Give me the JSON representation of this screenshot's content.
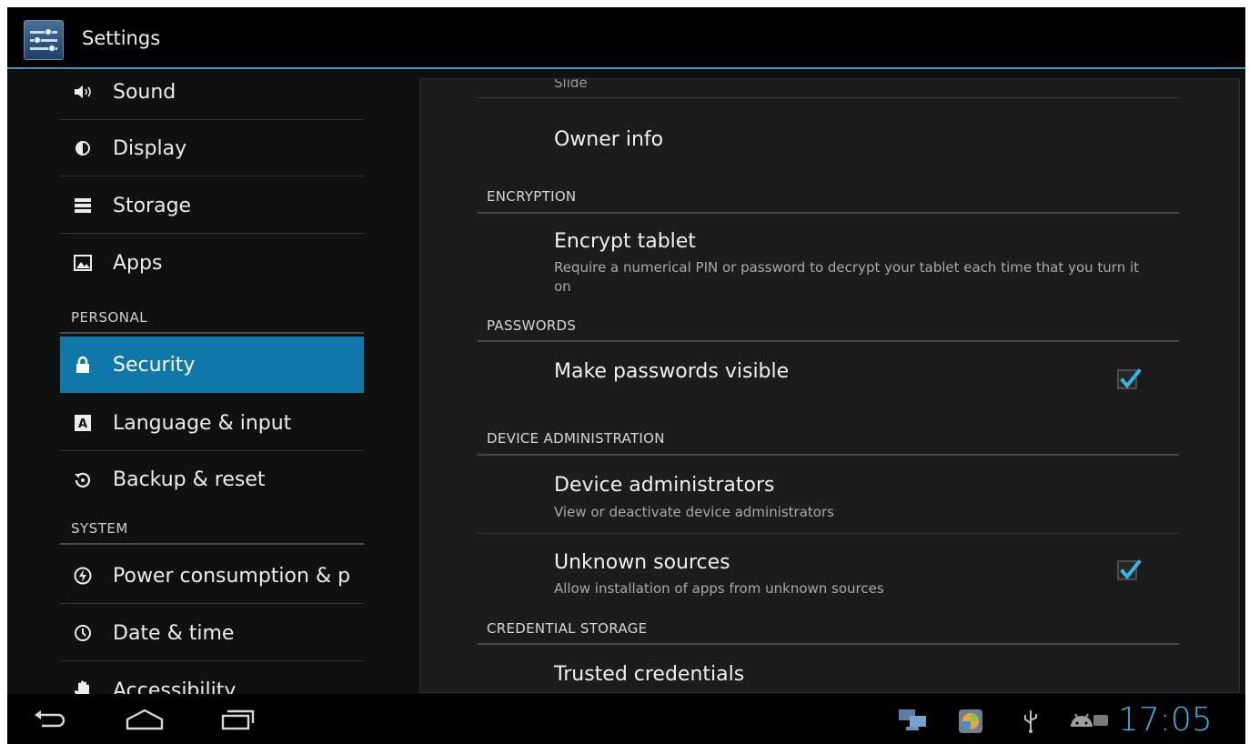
{
  "app": {
    "title": "Settings"
  },
  "sidebar": {
    "items": [
      {
        "label": "Sound",
        "icon": "speaker-icon"
      },
      {
        "label": "Display",
        "icon": "brightness-icon"
      },
      {
        "label": "Storage",
        "icon": "storage-icon"
      },
      {
        "label": "Apps",
        "icon": "apps-icon"
      },
      {
        "label": "Security",
        "icon": "lock-icon",
        "selected": true
      },
      {
        "label": "Language & input",
        "icon": "keyboard-a-icon"
      },
      {
        "label": "Backup & reset",
        "icon": "backup-icon"
      },
      {
        "label": "Power consumption & p",
        "icon": "power-icon"
      },
      {
        "label": "Date & time",
        "icon": "clock-icon"
      },
      {
        "label": "Accessibility",
        "icon": "hand-icon"
      }
    ],
    "headers": {
      "personal": "PERSONAL",
      "system": "SYSTEM"
    }
  },
  "security": {
    "cut_off_summary": "Slide",
    "owner_info": {
      "title": "Owner info"
    },
    "encryption": {
      "header": "ENCRYPTION",
      "encrypt_tablet": {
        "title": "Encrypt tablet",
        "summary": "Require a numerical PIN or password to decrypt your tablet each time that you turn it on"
      }
    },
    "passwords": {
      "header": "PASSWORDS",
      "make_visible": {
        "title": "Make passwords visible",
        "checked": true
      }
    },
    "device_admin": {
      "header": "DEVICE ADMINISTRATION",
      "administrators": {
        "title": "Device administrators",
        "summary": "View or deactivate device administrators"
      },
      "unknown_sources": {
        "title": "Unknown sources",
        "summary": "Allow installation of apps from unknown sources",
        "checked": true
      }
    },
    "credential_storage": {
      "header": "CREDENTIAL STORAGE",
      "trusted": {
        "title": "Trusted credentials"
      }
    }
  },
  "statusbar": {
    "clock": "17:05",
    "accent_color": "#33b5e5",
    "tray_icons": [
      "network-icon",
      "gallery-app-icon",
      "usb-icon",
      "android-debug-icon",
      "battery-icon"
    ]
  },
  "navbar": {
    "buttons": [
      "back",
      "home",
      "recent-apps"
    ]
  }
}
